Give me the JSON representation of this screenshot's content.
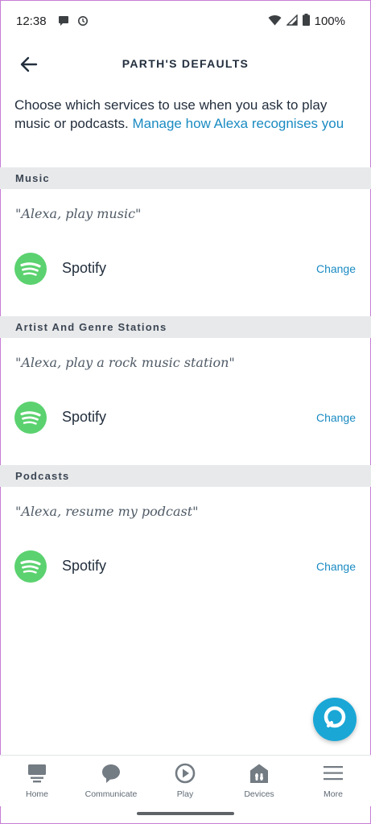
{
  "status_bar": {
    "time": "12:38",
    "battery": "100%",
    "icons": [
      "chat-bubble-icon",
      "clock-icon",
      "wifi-icon",
      "signal-icon",
      "battery-icon"
    ]
  },
  "header": {
    "title": "PARTH'S DEFAULTS",
    "back_icon": "arrow-left-icon"
  },
  "intro": {
    "text": "Choose which services to use when you ask to play music or podcasts. ",
    "link": "Manage how Alexa recognises you"
  },
  "sections": [
    {
      "title": "Music",
      "utterance": "\"Alexa, play music\"",
      "service": "Spotify",
      "action": "Change"
    },
    {
      "title": "Artist And Genre Stations",
      "utterance": "\"Alexa, play a rock music station\"",
      "service": "Spotify",
      "action": "Change"
    },
    {
      "title": "Podcasts",
      "utterance": "\"Alexa, resume my podcast\"",
      "service": "Spotify",
      "action": "Change"
    }
  ],
  "alexa_button": {
    "icon": "alexa-ring-icon"
  },
  "bottom_nav": {
    "items": [
      {
        "label": "Home",
        "icon": "home-icon"
      },
      {
        "label": "Communicate",
        "icon": "speech-bubble-icon"
      },
      {
        "label": "Play",
        "icon": "play-icon"
      },
      {
        "label": "Devices",
        "icon": "devices-icon"
      },
      {
        "label": "More",
        "icon": "menu-icon"
      }
    ]
  },
  "colors": {
    "accent": "#1a8bc2",
    "alexa_blue": "#1aa7d6",
    "spotify_green": "#5bd26f",
    "section_bg": "#e8e9ea",
    "text": "#232f3e",
    "nav_icon": "#737b83"
  }
}
